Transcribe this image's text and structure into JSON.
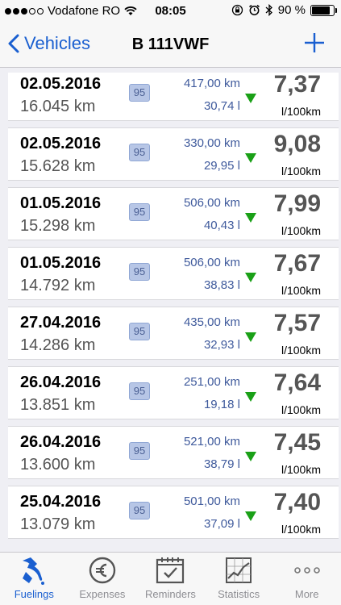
{
  "status": {
    "carrier": "Vodafone RO",
    "time": "08:05",
    "battery": "90 %"
  },
  "nav": {
    "back_label": "Vehicles",
    "title": "B 111VWF"
  },
  "entries": [
    {
      "date": "02.05.2016",
      "odometer": "16.045 km",
      "fuel": "95",
      "distance": "417,00 km",
      "volume": "30,74 l",
      "consumption": "7,37",
      "unit": "l/100km"
    },
    {
      "date": "02.05.2016",
      "odometer": "15.628 km",
      "fuel": "95",
      "distance": "330,00 km",
      "volume": "29,95 l",
      "consumption": "9,08",
      "unit": "l/100km"
    },
    {
      "date": "01.05.2016",
      "odometer": "15.298 km",
      "fuel": "95",
      "distance": "506,00 km",
      "volume": "40,43 l",
      "consumption": "7,99",
      "unit": "l/100km"
    },
    {
      "date": "01.05.2016",
      "odometer": "14.792 km",
      "fuel": "95",
      "distance": "506,00 km",
      "volume": "38,83 l",
      "consumption": "7,67",
      "unit": "l/100km"
    },
    {
      "date": "27.04.2016",
      "odometer": "14.286 km",
      "fuel": "95",
      "distance": "435,00 km",
      "volume": "32,93 l",
      "consumption": "7,57",
      "unit": "l/100km"
    },
    {
      "date": "26.04.2016",
      "odometer": "13.851 km",
      "fuel": "95",
      "distance": "251,00 km",
      "volume": "19,18 l",
      "consumption": "7,64",
      "unit": "l/100km"
    },
    {
      "date": "26.04.2016",
      "odometer": "13.600 km",
      "fuel": "95",
      "distance": "521,00 km",
      "volume": "38,79 l",
      "consumption": "7,45",
      "unit": "l/100km"
    },
    {
      "date": "25.04.2016",
      "odometer": "13.079 km",
      "fuel": "95",
      "distance": "501,00 km",
      "volume": "37,09 l",
      "consumption": "7,40",
      "unit": "l/100km"
    }
  ],
  "tabs": [
    {
      "label": "Fuelings",
      "icon": "fuel-pump-icon",
      "active": true
    },
    {
      "label": "Expenses",
      "icon": "euro-icon",
      "active": false
    },
    {
      "label": "Reminders",
      "icon": "calendar-icon",
      "active": false
    },
    {
      "label": "Statistics",
      "icon": "chart-icon",
      "active": false
    },
    {
      "label": "More",
      "icon": "more-icon",
      "active": false
    }
  ],
  "colors": {
    "accent": "#1a5fd0",
    "trend_down": "#1aa017",
    "fuel_badge": "#b7c6e6"
  }
}
